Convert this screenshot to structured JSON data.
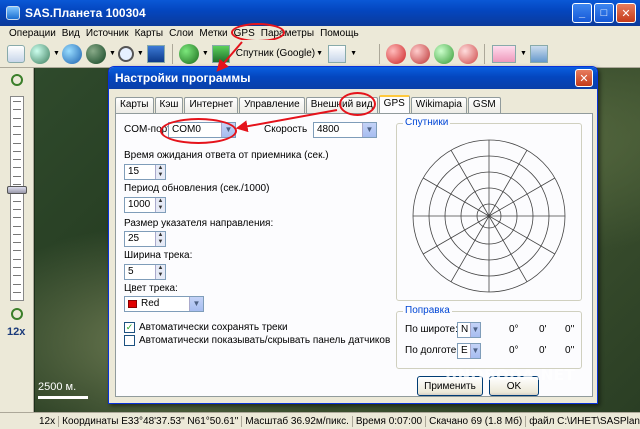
{
  "window": {
    "title": "SAS.Планета 100304"
  },
  "menu": [
    "Операции",
    "Вид",
    "Источник",
    "Карты",
    "Слои",
    "Метки",
    "GPS",
    "Параметры",
    "Помощь"
  ],
  "toolbar": {
    "map_source": "Спутник (Google)"
  },
  "zoom": {
    "level_label": "12x",
    "level_fraction": 0.45
  },
  "map": {
    "scale_label": "2500 м."
  },
  "status": [
    "12x",
    "Координаты E33°48'37.53\" N61°50.61\"",
    "Масштаб 36.92м/пикс.",
    "Время 0:07:00",
    "Скачано 69 (1.8 Мб)",
    "файл C:\\ИНЕТ\\SASPlane"
  ],
  "dialog": {
    "title": "Настройки программы",
    "tabs": [
      "Карты",
      "Кэш",
      "Интернет",
      "Управление",
      "Внешний вид",
      "GPS",
      "Wikimapia",
      "GSM"
    ],
    "active_tab": "GPS",
    "com_port": {
      "label": "COM-порт",
      "value": "COM0"
    },
    "speed": {
      "label": "Скорость",
      "value": "4800"
    },
    "timeout": {
      "label": "Время ожидания ответа от приемника (сек.)",
      "value": "15"
    },
    "refresh": {
      "label": "Период обновления (сек./1000)",
      "value": "1000"
    },
    "pointer_size": {
      "label": "Размер указателя направления:",
      "value": "25"
    },
    "track_width": {
      "label": "Ширина трека:",
      "value": "5"
    },
    "track_color": {
      "label": "Цвет трека:",
      "value": "Red",
      "color": "#e00000"
    },
    "auto_save": {
      "label": "Автоматически сохранять треки",
      "checked": true
    },
    "auto_panel": {
      "label": "Автоматически показывать/скрывать панель датчиков",
      "checked": false
    },
    "satellites_group": "Спутники",
    "correction": {
      "group_label": "Поправка",
      "lat_label": "По широте:",
      "lat_hemi": "N",
      "lon_label": "По долготе:",
      "lon_hemi": "E",
      "deg": "0°",
      "min": "0'",
      "sec": "0''"
    },
    "apply_button": "Применить",
    "ok_button": "OK"
  },
  "watermark": "UNOBODA.NET",
  "colors": {
    "title_blue": "#0446bf",
    "annotation_red": "#e5131b",
    "dialog_face": "#ece9d8"
  }
}
